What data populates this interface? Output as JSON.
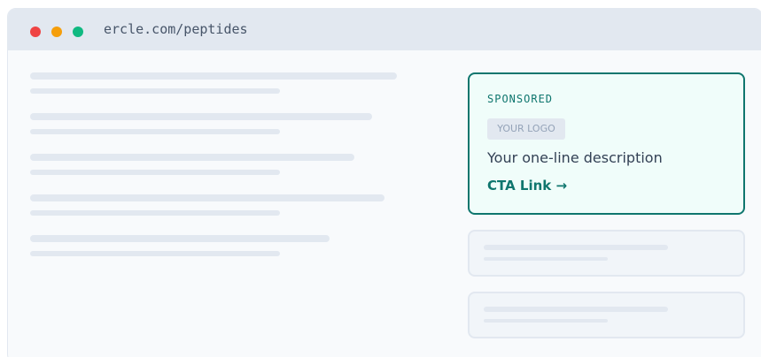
{
  "browser": {
    "url": "ercle.com/peptides"
  },
  "ad": {
    "label": "SPONSORED",
    "logo": "YOUR LOGO",
    "description": "Your one-line description",
    "cta": "CTA Link →"
  },
  "colors": {
    "accent": "#0f766e",
    "card_bg": "#f0fdfa",
    "placeholder": "#e2e8f0",
    "dot_red": "#ef4444",
    "dot_yellow": "#f59e0b",
    "dot_green": "#10b981"
  }
}
